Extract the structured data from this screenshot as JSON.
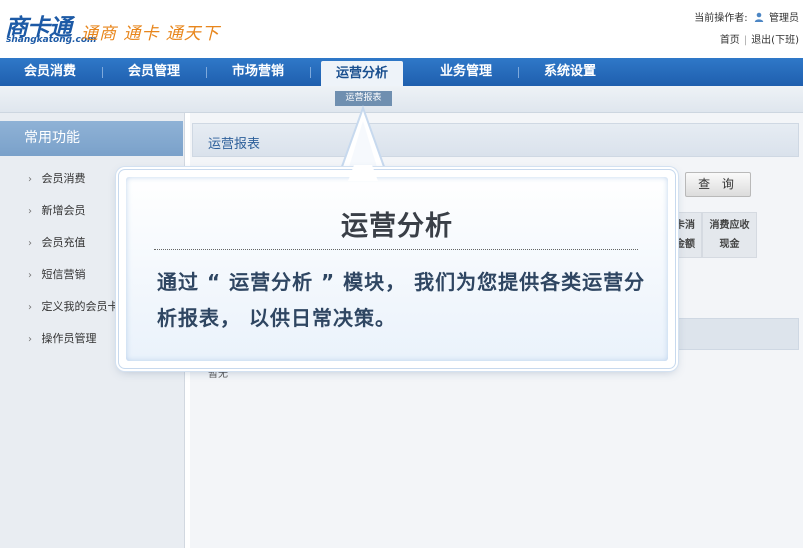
{
  "header": {
    "logo_main": "商卡通",
    "logo_sub": "shangkatong.com",
    "slogan": "通商 通卡 通天下",
    "operator_label": "当前操作者:",
    "operator_name": "管理员",
    "home_link": "首页",
    "logout_link": "退出(下班)"
  },
  "nav": {
    "items": [
      {
        "label": "会员消费"
      },
      {
        "label": "会员管理"
      },
      {
        "label": "市场营销"
      },
      {
        "label": "运营分析"
      },
      {
        "label": "业务管理"
      },
      {
        "label": "系统设置"
      }
    ],
    "active_index": 3,
    "sub_item": "运营报表"
  },
  "sidebar": {
    "title": "常用功能",
    "items": [
      {
        "label": "会员消费"
      },
      {
        "label": "新增会员"
      },
      {
        "label": "会员充值"
      },
      {
        "label": "短信营销"
      },
      {
        "label": "定义我的会员卡"
      },
      {
        "label": "操作员管理"
      }
    ]
  },
  "main": {
    "title": "运营报表",
    "query_button": "查 询",
    "headers": [
      {
        "line1": "卡消",
        "line2": "金额"
      },
      {
        "line1": "消费应收",
        "line2": "现金"
      }
    ],
    "empty_text": "暂无"
  },
  "callout": {
    "heading": "运营分析",
    "body": "通过 “ 运营分析 ” 模块， 我们为您提供各类运营分析报表， 以供日常决策。"
  },
  "colors": {
    "nav_blue": "#1f5fae",
    "brand_blue": "#1d5aa6",
    "slogan_orange": "#e8861c"
  }
}
